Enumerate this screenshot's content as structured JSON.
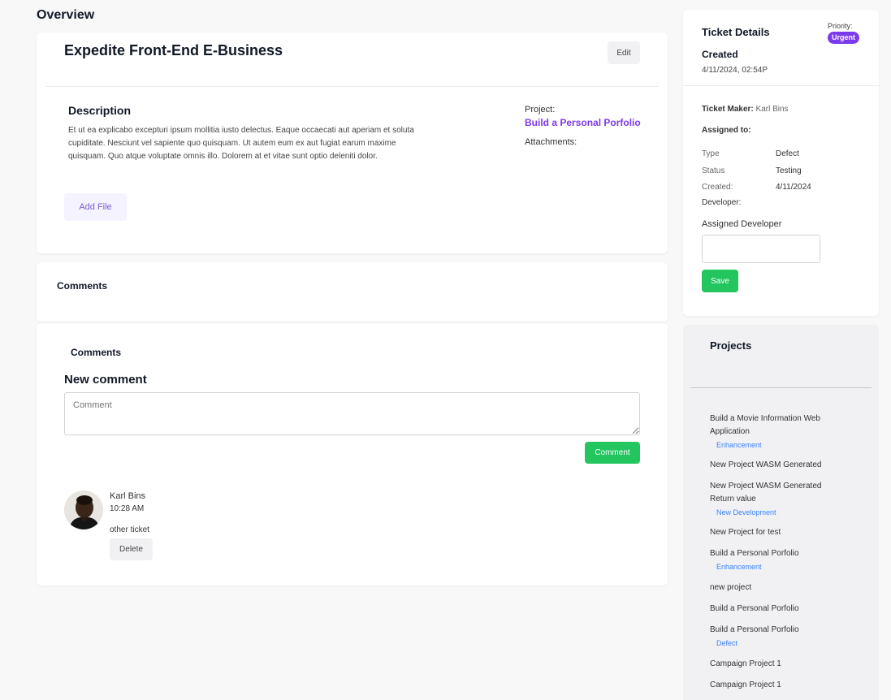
{
  "page": {
    "title": "Overview"
  },
  "ticket": {
    "title": "Expedite Front-End E-Business",
    "edit_label": "Edit",
    "description_heading": "Description",
    "description": "Et ut ea explicabo excepturi ipsum mollitia iusto delectus. Eaque occaecati aut aperiam et soluta cupiditate. Nesciunt vel sapiente quo quisquam. Ut autem eum ex aut fugiat earum maxime quisquam. Quo atque voluptate omnis illo. Dolorem at et vitae sunt optio deleniti dolor.",
    "add_file_label": "Add File",
    "project_label": "Project:",
    "project_name": "Build a Personal Porfolio",
    "attachments_label": "Attachments:"
  },
  "comments": {
    "header_title": "Comments",
    "section_title": "Comments",
    "new_comment_title": "New comment",
    "placeholder": "Comment",
    "submit_label": "Comment",
    "items": [
      {
        "author": "Karl Bins",
        "time": "10:28 AM",
        "text": "other ticket",
        "delete_label": "Delete"
      }
    ]
  },
  "details": {
    "title": "Ticket Details",
    "priority_label": "Priority:",
    "priority_value": "Urgent",
    "created_heading": "Created",
    "created_datetime": "4/11/2024, 02:54P",
    "maker_label": "Ticket Maker:",
    "maker_value": "Karl Bins",
    "assigned_label": "Assigned to:",
    "type_label": "Type",
    "type_value": "Defect",
    "status_label": "Status",
    "status_value": "Testing",
    "created_label": "Created:",
    "created_value": "4/11/2024",
    "developer_label": "Developer:",
    "assigned_dev_label": "Assigned Developer",
    "save_label": "Save"
  },
  "projects": {
    "title": "Projects",
    "items": [
      {
        "name": "Build a Movie Information Web Application",
        "tag": "Enhancement"
      },
      {
        "name": "New Project WASM Generated",
        "tag": ""
      },
      {
        "name": "New Project WASM Generated Return value",
        "tag": "New Development"
      },
      {
        "name": "New Project for test",
        "tag": ""
      },
      {
        "name": "Build a Personal Porfolio",
        "tag": "Enhancement"
      },
      {
        "name": "new project",
        "tag": ""
      },
      {
        "name": "Build a Personal Porfolio",
        "tag": ""
      },
      {
        "name": "Build a Personal Porfolio",
        "tag": "Defect"
      },
      {
        "name": "Campaign Project 1",
        "tag": ""
      },
      {
        "name": "Campaign Project 1",
        "tag": ""
      }
    ]
  },
  "colors": {
    "accent_purple": "#7c3aed",
    "success_green": "#22c55e",
    "tag_blue": "#3b82f6"
  }
}
